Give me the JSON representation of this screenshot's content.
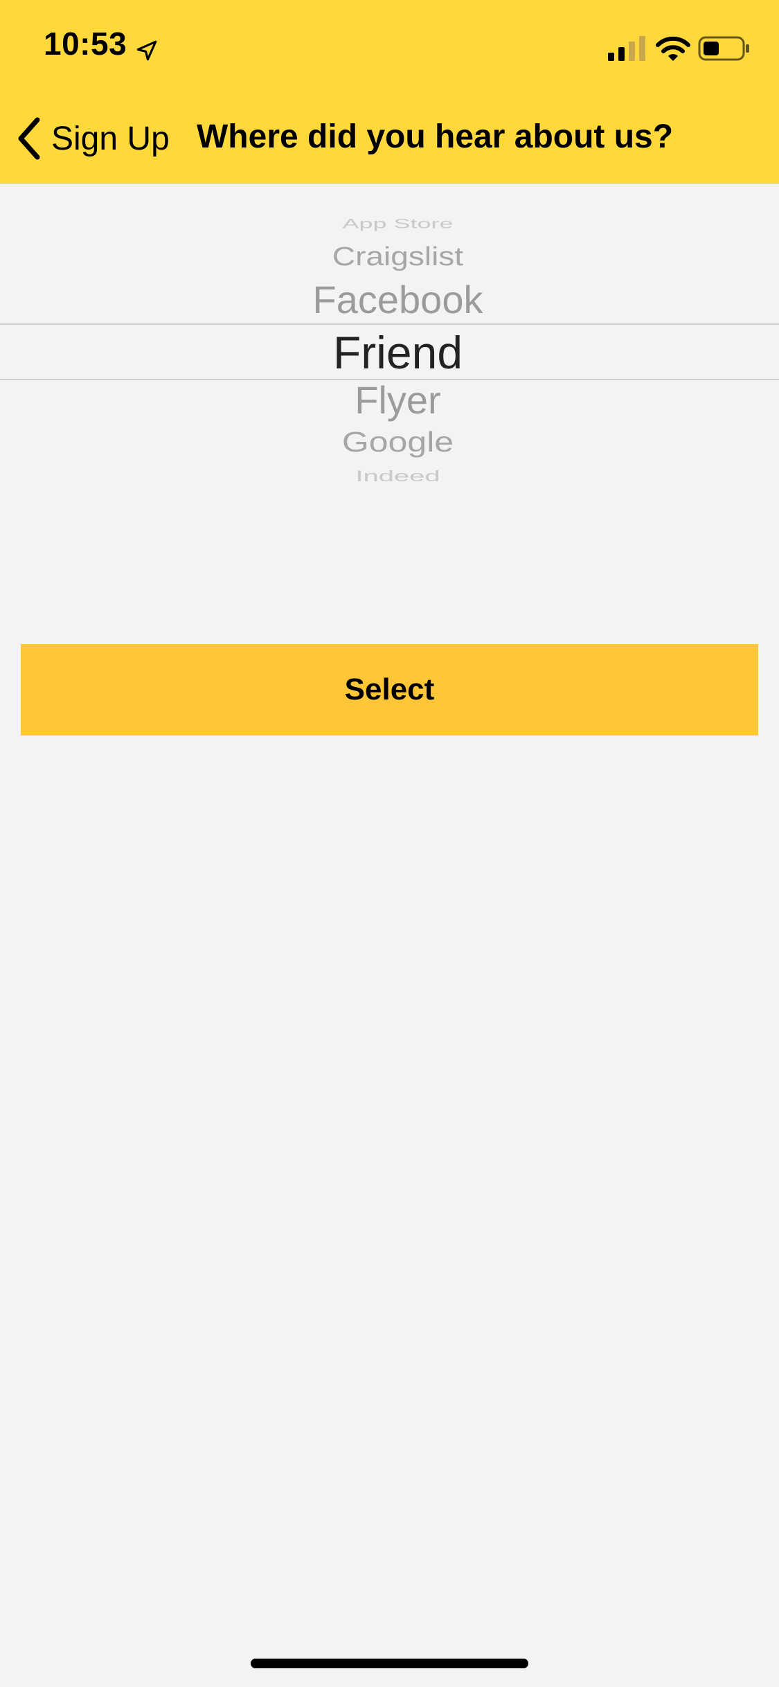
{
  "status_bar": {
    "time": "10:53",
    "location_icon": "location-arrow-icon",
    "signal_icon": "cellular-signal-icon",
    "wifi_icon": "wifi-icon",
    "battery_icon": "battery-icon"
  },
  "nav": {
    "back_label": "Sign Up",
    "back_icon": "chevron-left-icon",
    "title": "Where did you hear about us?"
  },
  "picker": {
    "selected": "Friend",
    "items": [
      {
        "label": "App Store"
      },
      {
        "label": "Craigslist"
      },
      {
        "label": "Facebook"
      },
      {
        "label": "Friend"
      },
      {
        "label": "Flyer"
      },
      {
        "label": "Google"
      },
      {
        "label": "Indeed"
      }
    ]
  },
  "select_button": {
    "label": "Select"
  },
  "colors": {
    "header_bg": "#ffd83c",
    "button_bg": "#ffc638",
    "background": "#f3f3f3"
  }
}
